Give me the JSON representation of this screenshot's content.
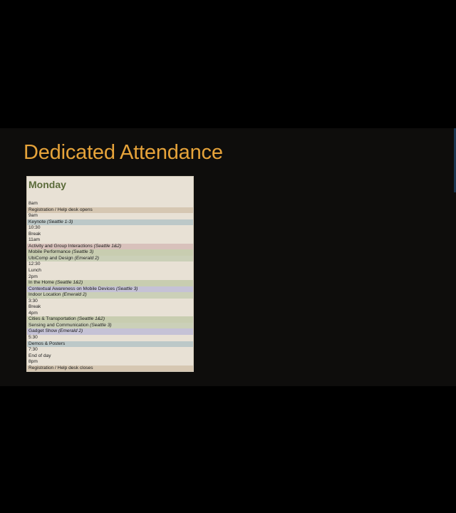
{
  "slide": {
    "title": "Dedicated Attendance"
  },
  "schedule": {
    "day": "Monday",
    "rows": [
      {
        "kind": "time",
        "text": "8am"
      },
      {
        "kind": "event",
        "text": "Registration / Help desk opens",
        "room": "",
        "color": "#d6c7b2"
      },
      {
        "kind": "time",
        "text": "9am"
      },
      {
        "kind": "event",
        "text": "Keynote",
        "room": "(Seattle 1-3)",
        "color": "#bcc8c8"
      },
      {
        "kind": "time",
        "text": "10:30"
      },
      {
        "kind": "time",
        "text": "Break"
      },
      {
        "kind": "time",
        "text": "11am"
      },
      {
        "kind": "event",
        "text": "Activity and Group Interactions",
        "room": "(Seattle 1&2)",
        "color": "#d8c1bb"
      },
      {
        "kind": "event",
        "text": "Mobile Performance",
        "room": "(Seattle 3)",
        "color": "#c8cdb0"
      },
      {
        "kind": "event",
        "text": "UbiComp and Design",
        "room": "(Emerald 2)",
        "color": "#cbd0b8"
      },
      {
        "kind": "time",
        "text": "12:30"
      },
      {
        "kind": "time",
        "text": "Lunch"
      },
      {
        "kind": "time",
        "text": "2pm"
      },
      {
        "kind": "event",
        "text": "In the Home",
        "room": "(Seattle 1&2)",
        "color": "#c8cdb0"
      },
      {
        "kind": "event",
        "text": "Contextual Awareness on Mobile Devices",
        "room": "(Seattle 3)",
        "color": "#c5c2d6"
      },
      {
        "kind": "event",
        "text": "Indoor Location",
        "room": "(Emerald 2)",
        "color": "#cbd0b8"
      },
      {
        "kind": "time",
        "text": "3:30"
      },
      {
        "kind": "time",
        "text": "Break"
      },
      {
        "kind": "time",
        "text": "4pm"
      },
      {
        "kind": "event",
        "text": "Cities & Transportation",
        "room": "(Seattle 1&2)",
        "color": "#c8cdb0"
      },
      {
        "kind": "event",
        "text": "Sensing and Communication",
        "room": "(Seattle 3)",
        "color": "#cbd0b8"
      },
      {
        "kind": "event",
        "text": "Gadget Show",
        "room": "(Emerald 2)",
        "color": "#c5c2d6"
      },
      {
        "kind": "time",
        "text": "5:30"
      },
      {
        "kind": "event",
        "text": "Demos & Posters",
        "room": "",
        "color": "#bcc8c8"
      },
      {
        "kind": "time",
        "text": "7:30"
      },
      {
        "kind": "time",
        "text": "End of day"
      },
      {
        "kind": "time",
        "text": "8pm"
      },
      {
        "kind": "event",
        "text": "Registration / Help desk closes",
        "room": "",
        "color": "#d6c7b2"
      }
    ]
  }
}
